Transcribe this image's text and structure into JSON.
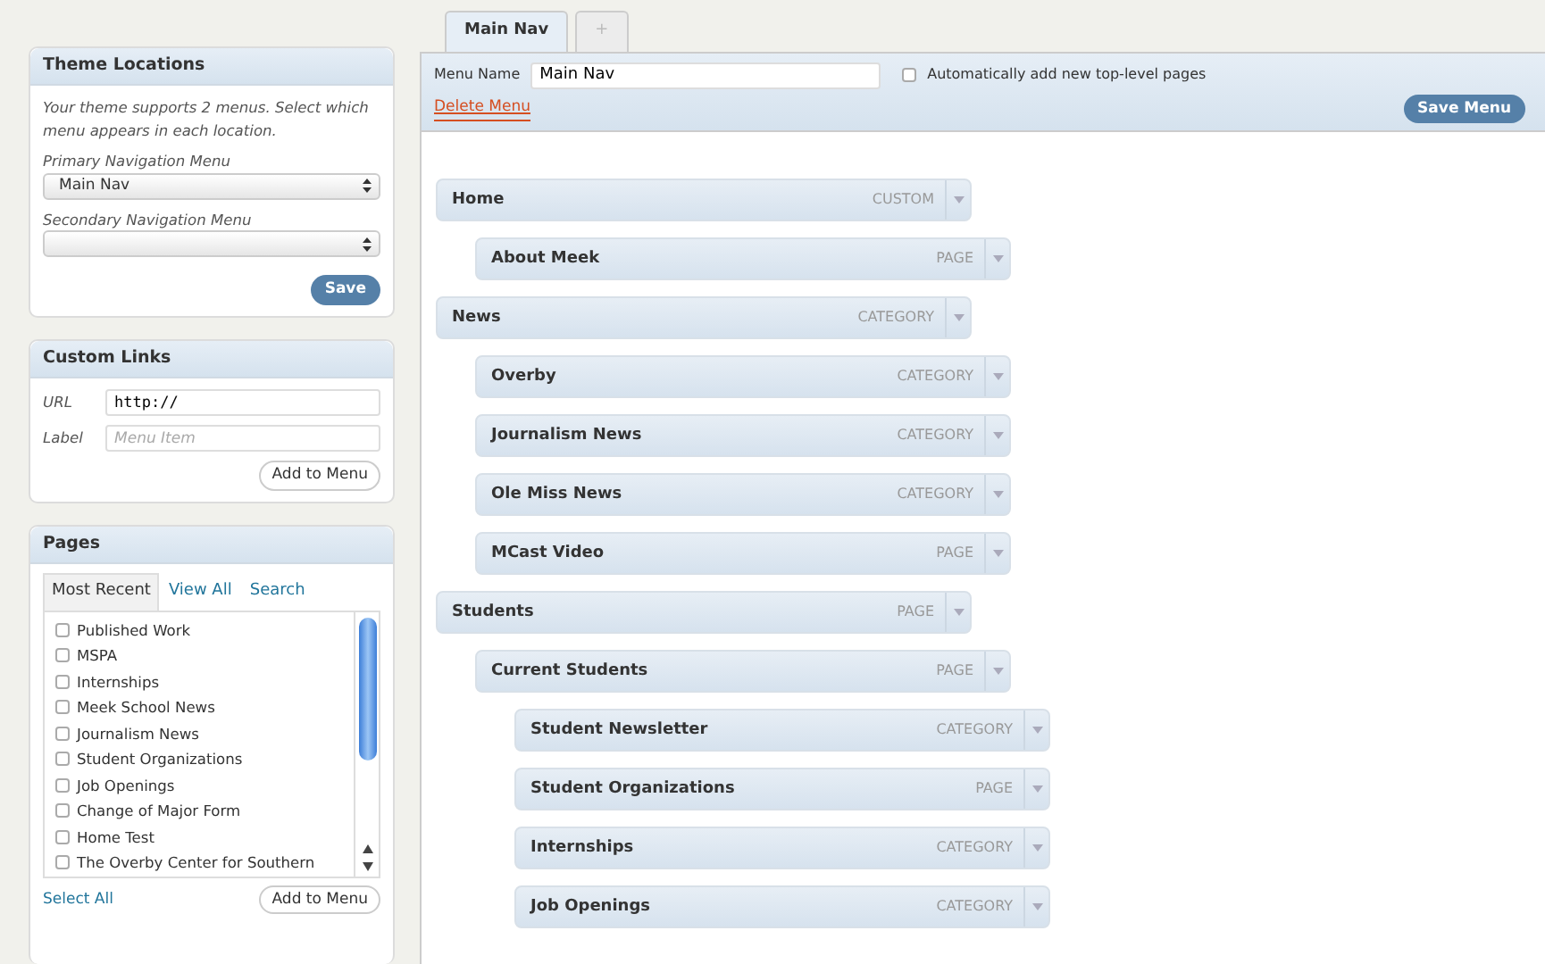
{
  "theme_locations": {
    "title": "Theme Locations",
    "description": "Your theme supports 2 menus. Select which menu appears in each location.",
    "fields": [
      {
        "label": "Primary Navigation Menu",
        "value": "Main Nav"
      },
      {
        "label": "Secondary Navigation Menu"
      }
    ],
    "button": "Save"
  },
  "custom_links": {
    "title": "Custom Links",
    "url_label": "URL",
    "url_value": "http://",
    "label_label": "Label",
    "label_placeholder": "Menu Item",
    "button": "Add to Menu"
  },
  "pages": {
    "title": "Pages",
    "tabs": [
      {
        "label": "Most Recent",
        "selected": true
      },
      {
        "label": "View All",
        "selected": false
      },
      {
        "label": "Search",
        "selected": false
      }
    ],
    "items": [
      {
        "label": "Published Work",
        "checked": false
      },
      {
        "label": "MSPA",
        "checked": false
      },
      {
        "label": "Internships",
        "checked": false
      },
      {
        "label": "Meek School News",
        "checked": false
      },
      {
        "label": "Journalism News",
        "checked": false
      },
      {
        "label": "Student Organizations",
        "checked": false
      },
      {
        "label": "Job Openings",
        "checked": false
      },
      {
        "label": "Change of Major Form",
        "checked": false
      },
      {
        "label": "Home Test",
        "checked": false
      },
      {
        "label": "The Overby Center for Southern",
        "checked": false
      }
    ],
    "select_all": "Select All",
    "button": "Add to Menu"
  },
  "menu_tabs": [
    {
      "label": "Main Nav",
      "selected": true
    },
    {
      "label": "+",
      "selected": false
    }
  ],
  "menu_header": {
    "name_label": "Menu Name",
    "name_value": "Main Nav",
    "auto_add_label": "Automatically add new top-level pages",
    "auto_add_checked": false,
    "delete": "Delete Menu",
    "save": "Save Menu"
  },
  "menu_items": [
    {
      "title": "Home",
      "type": "CUSTOM",
      "children": [
        {
          "title": "About Meek",
          "type": "PAGE"
        }
      ]
    },
    {
      "title": "News",
      "type": "CATEGORY",
      "children": [
        {
          "title": "Overby",
          "type": "CATEGORY"
        },
        {
          "title": "Journalism News",
          "type": "CATEGORY"
        },
        {
          "title": "Ole Miss News",
          "type": "CATEGORY"
        },
        {
          "title": "MCast Video",
          "type": "PAGE"
        }
      ]
    },
    {
      "title": "Students",
      "type": "PAGE",
      "children": [
        {
          "title": "Current Students",
          "type": "PAGE",
          "children": [
            {
              "title": "Student Newsletter",
              "type": "CATEGORY"
            },
            {
              "title": "Student Organizations",
              "type": "PAGE"
            },
            {
              "title": "Internships",
              "type": "CATEGORY"
            },
            {
              "title": "Job Openings",
              "type": "CATEGORY"
            }
          ]
        }
      ]
    }
  ]
}
